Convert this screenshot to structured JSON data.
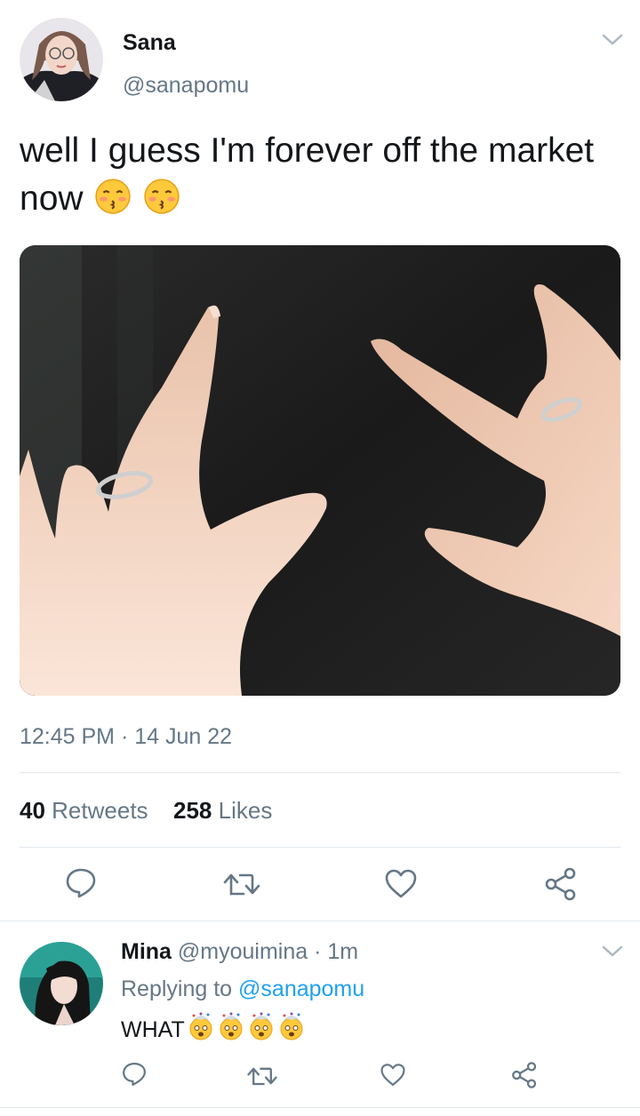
{
  "tweet": {
    "author_name": "Sana",
    "author_handle": "@sanapomu",
    "text": "well I guess I'm forever off the market now",
    "emoji_names": [
      "kissing-face-with-closed-eyes",
      "kissing-face-with-closed-eyes"
    ],
    "timestamp": "12:45 PM · 14 Jun 22",
    "retweets_count": "40",
    "retweets_label": "Retweets",
    "likes_count": "258",
    "likes_label": "Likes",
    "actions": [
      "reply-icon",
      "retweet-icon",
      "like-icon",
      "share-icon"
    ]
  },
  "reply": {
    "author_name": "Mina",
    "author_handle": "@myouimina",
    "separator": " · ",
    "time": "1m",
    "replying_prefix": "Replying to",
    "replying_to": "@sanapomu",
    "text": "WHAT",
    "emoji_names": [
      "exploding-head",
      "exploding-head",
      "exploding-head",
      "exploding-head"
    ],
    "actions": [
      "reply-icon",
      "retweet-icon",
      "like-icon",
      "share-icon"
    ]
  },
  "colors": {
    "text": "#14171a",
    "muted": "#657786",
    "link": "#1da1f2",
    "divider": "#e1e8ed"
  }
}
